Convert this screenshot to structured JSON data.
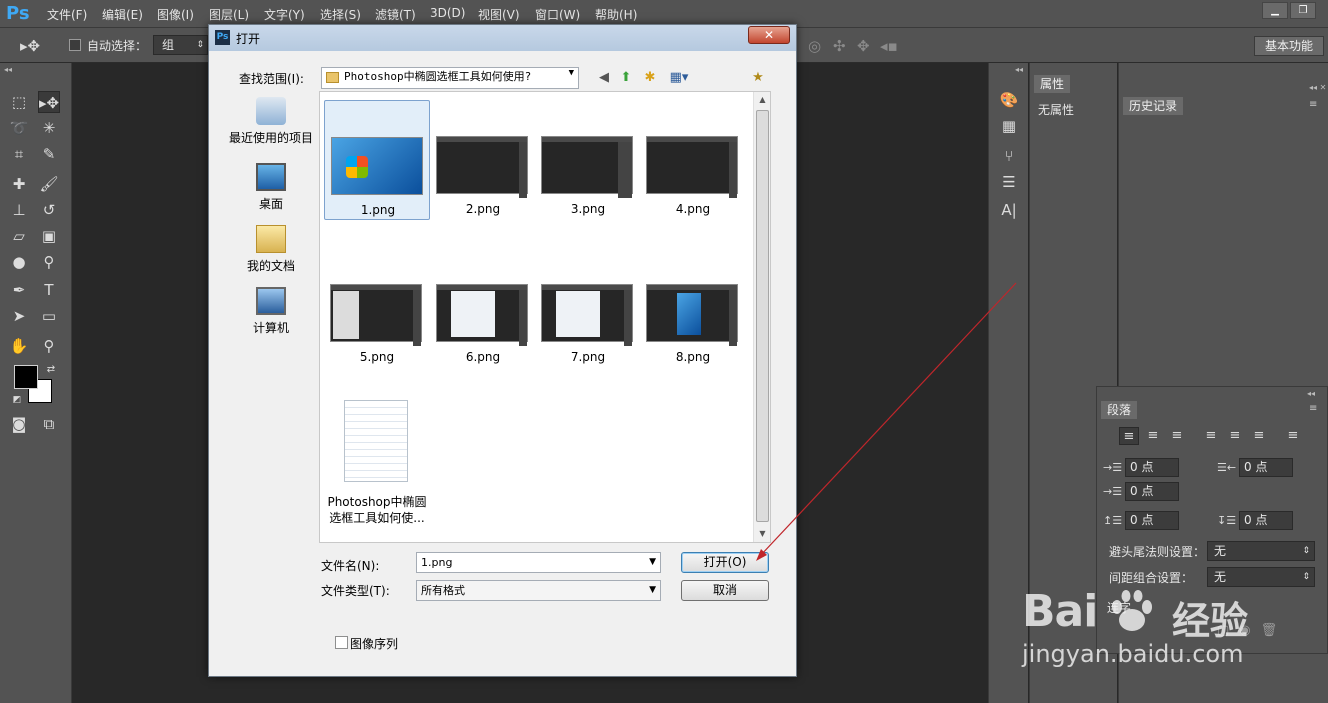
{
  "app": {
    "logo": "Ps",
    "menu": [
      "文件(F)",
      "编辑(E)",
      "图像(I)",
      "图层(L)",
      "文字(Y)",
      "选择(S)",
      "滤镜(T)",
      "3D(D)",
      "视图(V)",
      "窗口(W)",
      "帮助(H)"
    ]
  },
  "options_bar": {
    "auto_select_label": "自动选择：",
    "auto_select_value": "组",
    "workspace": "基本功能"
  },
  "panels": {
    "properties_tab": "属性",
    "properties_text": "无属性",
    "history_tab": "历史记录",
    "paragraph_tab": "段落",
    "fields": [
      "0 点",
      "0 点",
      "0 点",
      "0 点",
      "0 点"
    ],
    "kinsoku_label": "避头尾法则设置：",
    "kinsoku_value": "无",
    "mojikumi_label": "间距组合设置：",
    "mojikumi_value": "无",
    "hyphenate_label": "连字"
  },
  "dialog": {
    "title": "打开",
    "look_in_label": "查找范围(I):",
    "look_in_value": "Photoshop中椭圆选框工具如何使用?",
    "places": [
      "最近使用的项目",
      "桌面",
      "我的文档",
      "计算机"
    ],
    "files": [
      {
        "name": "1.png"
      },
      {
        "name": "2.png"
      },
      {
        "name": "3.png"
      },
      {
        "name": "4.png"
      },
      {
        "name": "5.png"
      },
      {
        "name": "6.png"
      },
      {
        "name": "7.png"
      },
      {
        "name": "8.png"
      },
      {
        "name": "Photoshop中椭圆选框工具如何使..."
      }
    ],
    "filename_label": "文件名(N):",
    "filename_value": "1.png",
    "filetype_label": "文件类型(T):",
    "filetype_value": "所有格式",
    "open_button": "打开(O)",
    "cancel_button": "取消",
    "image_sequence_label": "图像序列"
  },
  "watermark": {
    "logo_left": "Bai",
    "logo_right": "经验",
    "url": "jingyan.baidu.com"
  },
  "colors": {
    "ps_bg": "#535353",
    "canvas": "#282828",
    "annotation_arrow": "#c0262b"
  }
}
